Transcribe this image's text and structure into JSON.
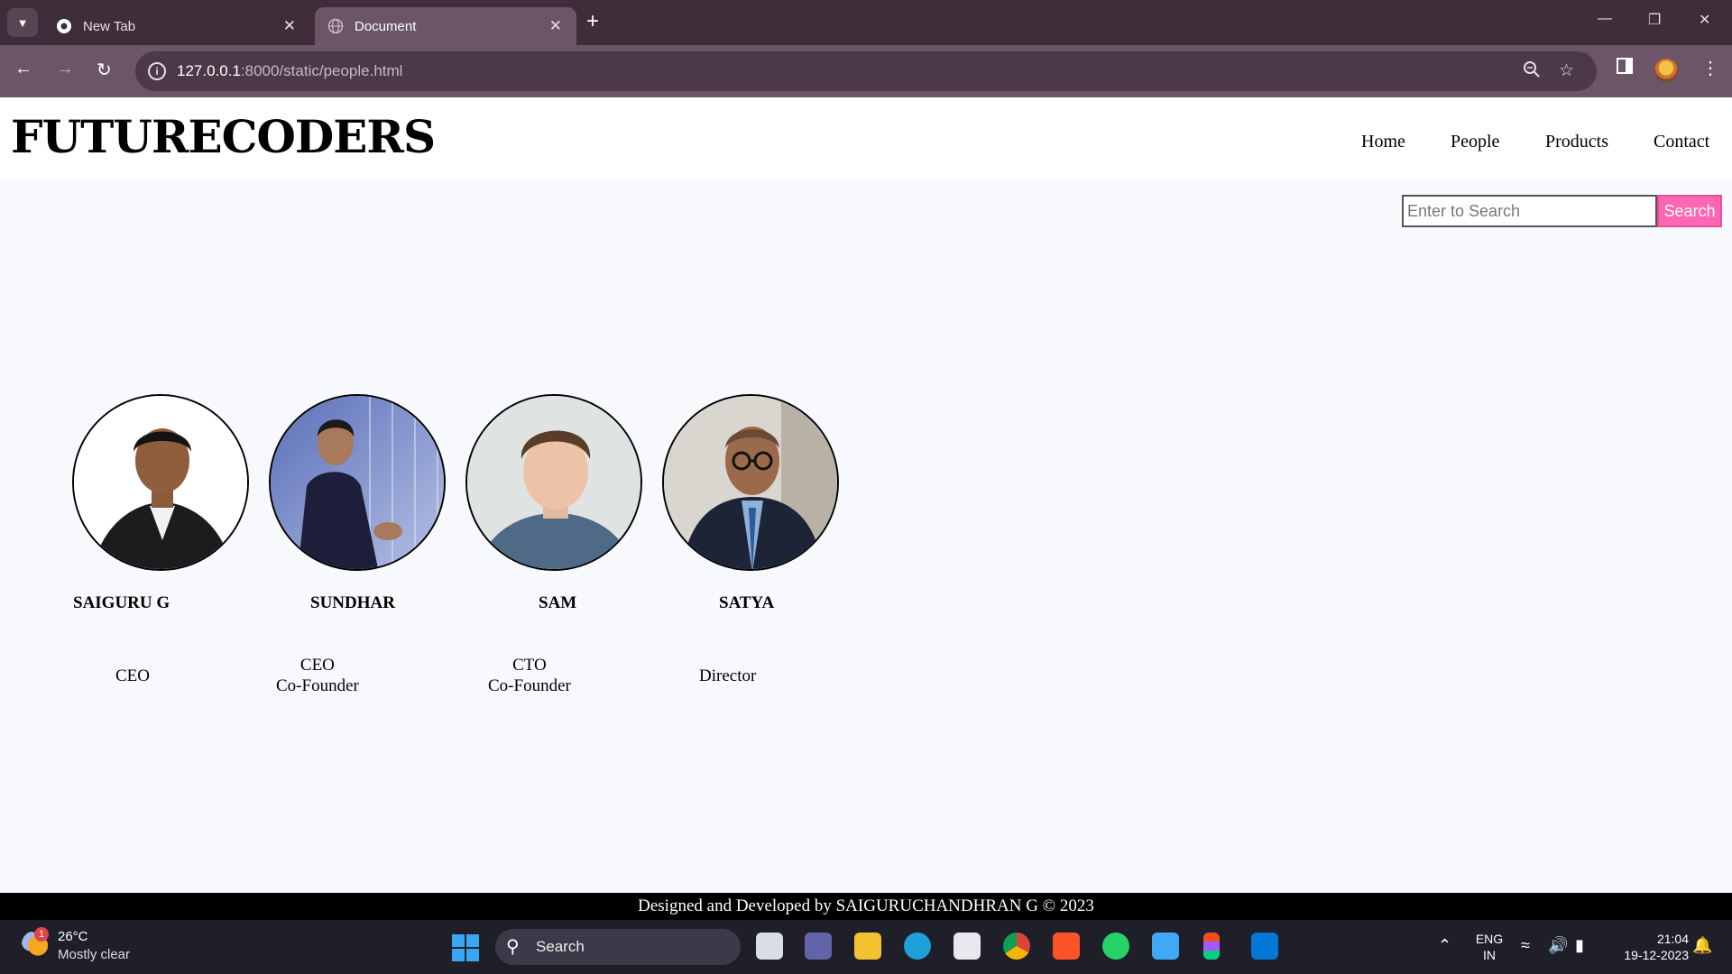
{
  "browser": {
    "tabs": [
      {
        "title": "New Tab",
        "active": false
      },
      {
        "title": "Document",
        "active": true
      }
    ],
    "url_host": "127.0.0.1",
    "url_rest": ":8000/static/people.html"
  },
  "site": {
    "logo": "FUTURECODERS",
    "nav": [
      "Home",
      "People",
      "Products",
      "Contact"
    ],
    "search": {
      "placeholder": "Enter to Search",
      "button": "Search"
    },
    "people": [
      {
        "name": "SAIGURU G",
        "role_lines": [
          "CEO"
        ]
      },
      {
        "name": "SUNDHAR",
        "role_lines": [
          "CEO",
          "Co-Founder"
        ]
      },
      {
        "name": "SAM",
        "role_lines": [
          "CTO",
          "Co-Founder"
        ]
      },
      {
        "name": "SATYA",
        "role_lines": [
          "Director"
        ]
      }
    ],
    "footer": "Designed and Developed by SAIGURUCHANDHRAN G © 2023"
  },
  "taskbar": {
    "weather_badge": "1",
    "weather_temp": "26°C",
    "weather_desc": "Mostly clear",
    "search_label": "Search",
    "lang_1": "ENG",
    "lang_2": "IN",
    "time": "21:04",
    "date": "19-12-2023"
  },
  "colors": {
    "tabbar": "#3f2e3a",
    "toolbar": "#6b5566",
    "search_button": "#ff66b3",
    "page_bg": "#f8f9fc",
    "taskbar": "#1f1f2a"
  }
}
